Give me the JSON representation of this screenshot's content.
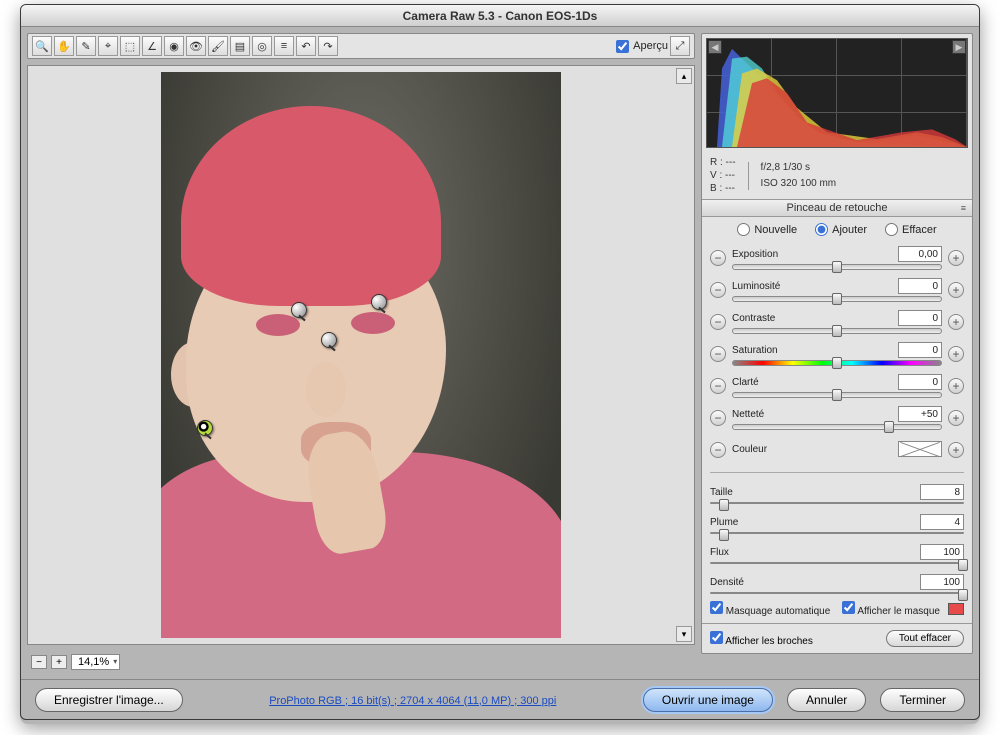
{
  "window": {
    "title": "Camera Raw 5.3  -  Canon EOS-1Ds"
  },
  "toolbar": {
    "preview_label": "Aperçu",
    "preview_checked": true,
    "tools": [
      "zoom",
      "hand",
      "eyedrop-white",
      "sampler",
      "crop",
      "straighten",
      "spot",
      "redeye",
      "brush",
      "grad",
      "target",
      "prefs",
      "rotate-l",
      "rotate-r"
    ]
  },
  "zoom": {
    "value": "14,1%"
  },
  "meta": {
    "r": "R :   ---",
    "v": "V :   ---",
    "b": "B :   ---",
    "aperture_shutter": "f/2,8    1/30 s",
    "iso_focal": "ISO 320    100 mm"
  },
  "panel": {
    "title": "Pinceau de retouche",
    "modes": {
      "new": "Nouvelle",
      "add": "Ajouter",
      "erase": "Effacer",
      "selected": "add"
    },
    "sliders": [
      {
        "name": "Exposition",
        "value": "0,00",
        "pos": 50
      },
      {
        "name": "Luminosité",
        "value": "0",
        "pos": 50
      },
      {
        "name": "Contraste",
        "value": "0",
        "pos": 50
      },
      {
        "name": "Saturation",
        "value": "0",
        "pos": 50,
        "rainbow": true
      },
      {
        "name": "Clarté",
        "value": "0",
        "pos": 50
      },
      {
        "name": "Netteté",
        "value": "+50",
        "pos": 75
      }
    ],
    "color_label": "Couleur",
    "brush": [
      {
        "name": "Taille",
        "value": "8",
        "pos": 5
      },
      {
        "name": "Plume",
        "value": "4",
        "pos": 5
      },
      {
        "name": "Flux",
        "value": "100",
        "pos": 100
      },
      {
        "name": "Densité",
        "value": "100",
        "pos": 100
      }
    ],
    "mask_auto": "Masquage automatique",
    "mask_show": "Afficher le masque",
    "pins_show": "Afficher les broches",
    "clear_all": "Tout effacer"
  },
  "footer": {
    "save": "Enregistrer l'image...",
    "profile_link": "ProPhoto RGB ; 16 bit(s) ; 2704 x 4064 (11,0 MP) ; 300 ppi",
    "open": "Ouvrir une image",
    "cancel": "Annuler",
    "done": "Terminer"
  }
}
